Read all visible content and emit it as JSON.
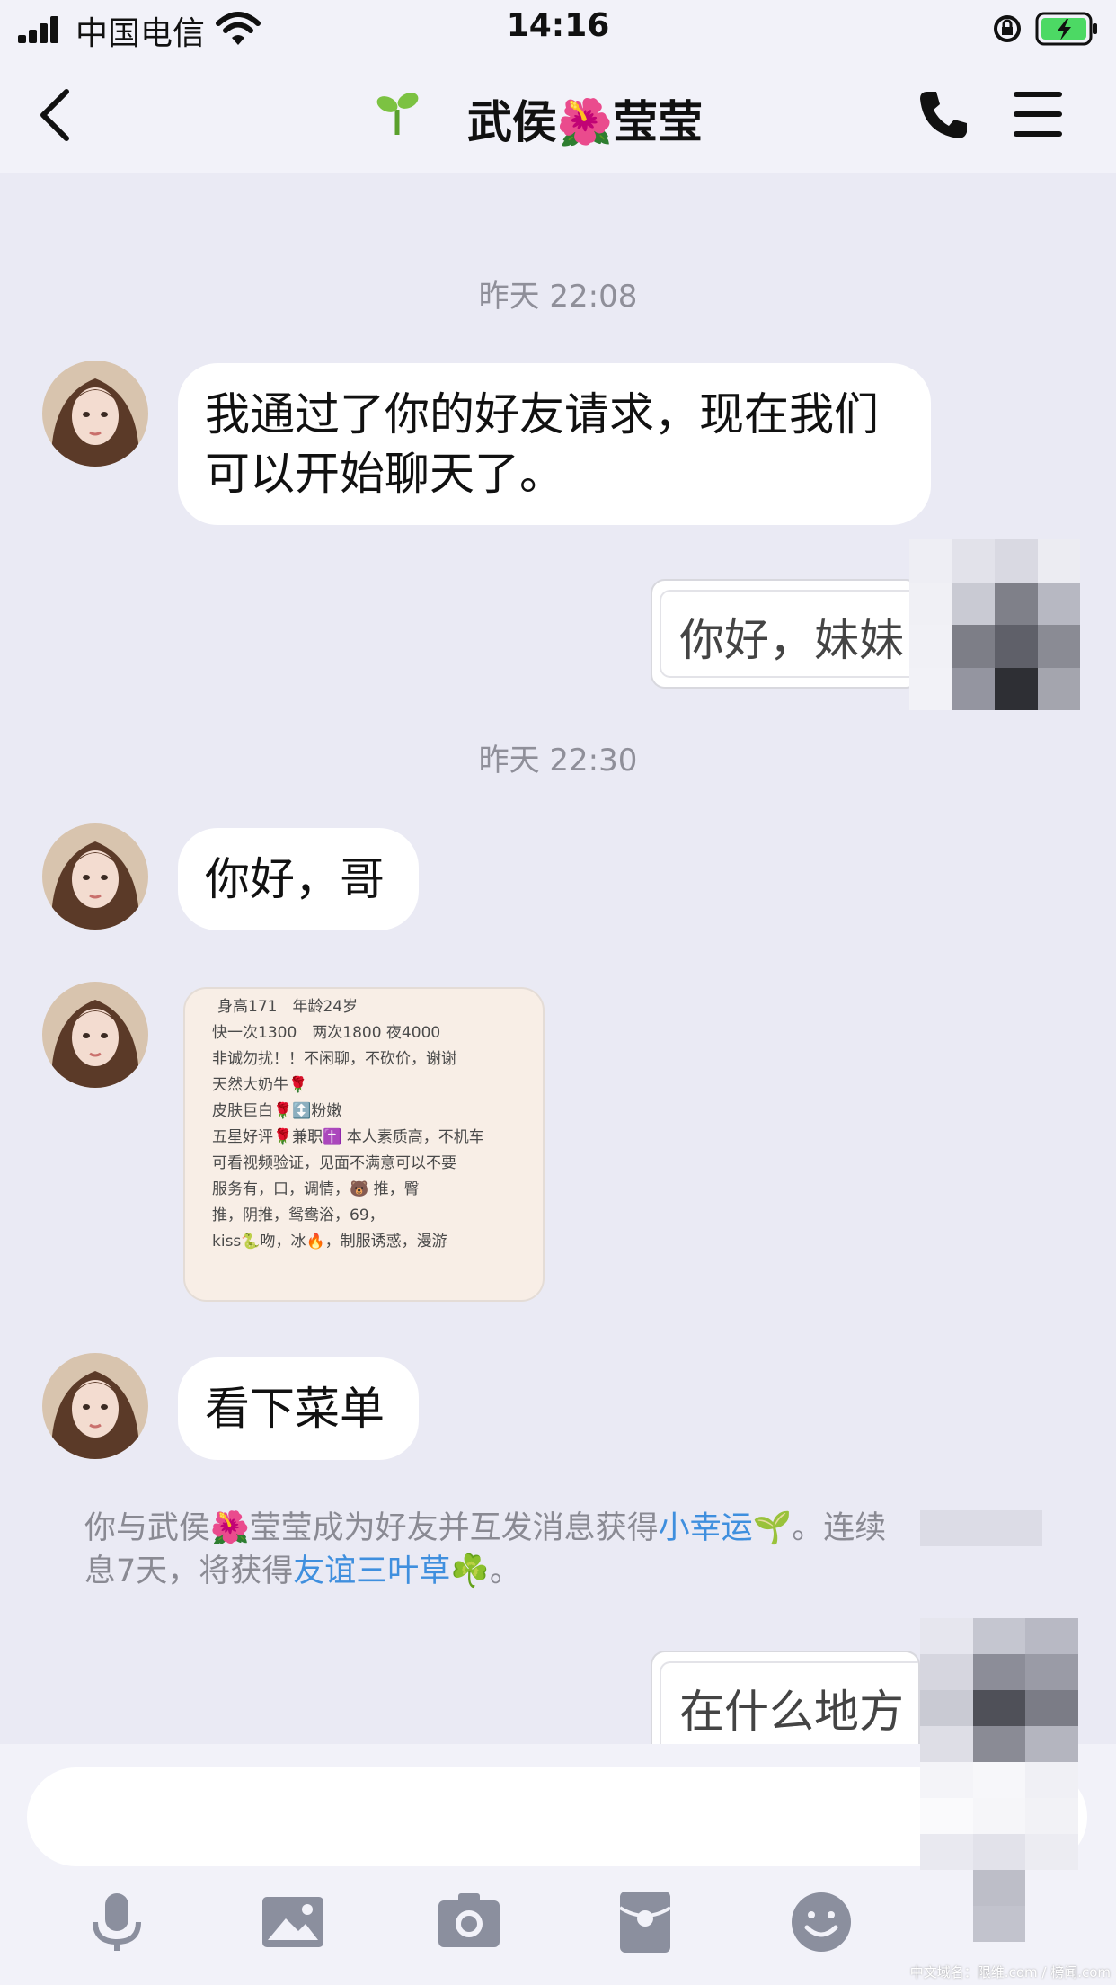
{
  "status_bar": {
    "carrier": "中国电信",
    "time": "14:16"
  },
  "nav": {
    "title": "武侯🌺莹莹",
    "title_prefix_icon": "sprout-icon",
    "back_icon": "chevron-left-icon",
    "call_icon": "phone-icon",
    "menu_icon": "hamburger-menu-icon"
  },
  "messages": {
    "timestamp_1": "昨天 22:08",
    "msg_1": "我通过了你的好友请求，现在我们可以开始聊天了。",
    "msg_2_out": "你好，妹妹",
    "timestamp_2": "昨天 22:30",
    "msg_3": "你好，哥",
    "msg_5": "看下菜单",
    "msg_6_out": "在什么地方"
  },
  "menu_image": {
    "lines": [
      "身高171　年龄24岁",
      "快一次1300　两次1800 夜4000",
      "非诚勿扰！！不闲聊，不砍价，谢谢",
      "天然大奶牛🌹",
      "皮肤巨白🌹↕️粉嫩",
      "五星好评🌹兼职✝️ 本人素质高，不机车",
      "可看视频验证，见面不满意可以不要",
      "服务有，口，调情，🐻 推，臀",
      "推，阴推，鸳鸯浴，69，",
      "kiss🐍吻，冰🔥，制服诱惑，漫游"
    ]
  },
  "system_note": {
    "part1": "你与武侯🌺莹莹成为好友并互发消息获得",
    "link1": "小幸运",
    "part2": "🌱。连续",
    "part3": "息7天，将获得",
    "link2": "友谊三叶草",
    "part4": "☘️。"
  },
  "toolbar": {
    "icons": [
      "microphone-icon",
      "image-icon",
      "camera-icon",
      "red-packet-icon",
      "emoji-icon"
    ]
  },
  "watermark": "中文域名：限维.com / 榜闻.com",
  "colors": {
    "background": "#eaeaf4",
    "bar": "#f2f2f9",
    "link": "#3f8fde",
    "battery": "#4cd964"
  }
}
